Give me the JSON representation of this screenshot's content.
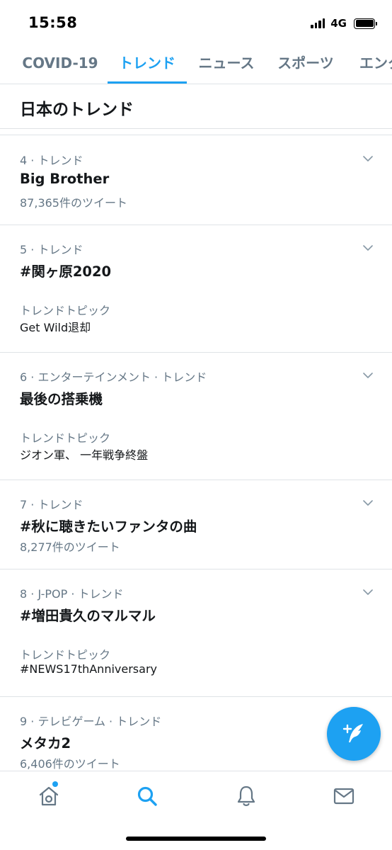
{
  "status_bar": {
    "time": "15:58",
    "network": "4G"
  },
  "tabs": [
    {
      "label": "COVID-19",
      "active": false
    },
    {
      "label": "トレンド",
      "active": true
    },
    {
      "label": "ニュース",
      "active": false
    },
    {
      "label": "スポーツ",
      "active": false
    },
    {
      "label": "エンタ",
      "active": false
    }
  ],
  "section_title": "日本のトレンド",
  "trends": [
    {
      "meta": "4 · トレンド",
      "name": "Big Brother",
      "count": "87,365件のツイート"
    },
    {
      "meta": "5 · トレンド",
      "name": "#関ヶ原2020",
      "topic_label": "トレンドトピック",
      "topic": "Get Wild退却"
    },
    {
      "meta": "6 · エンターテインメント · トレンド",
      "name": "最後の搭乗機",
      "topic_label": "トレンドトピック",
      "topic": "ジオン軍、 一年戦争終盤"
    },
    {
      "meta": "7 · トレンド",
      "name": "#秋に聴きたいファンタの曲",
      "count": "8,277件のツイート"
    },
    {
      "meta": "8 · J-POP · トレンド",
      "name": "#増田貴久のマルマル",
      "topic_label": "トレンドトピック",
      "topic": "#NEWS17thAnniversary"
    },
    {
      "meta": "9 · テレビゲーム · トレンド",
      "name": "メタカ2",
      "count": "6,406件のツイート"
    }
  ],
  "icons": {
    "fab": "compose-tweet-icon",
    "nav": [
      "home-icon",
      "search-icon",
      "bell-icon",
      "mail-icon"
    ],
    "row": "chevron-down-icon"
  },
  "colors": {
    "accent": "#1da1f2",
    "secondary_text": "#657786",
    "primary_text": "#14171a",
    "divider": "#dfe3e6"
  }
}
